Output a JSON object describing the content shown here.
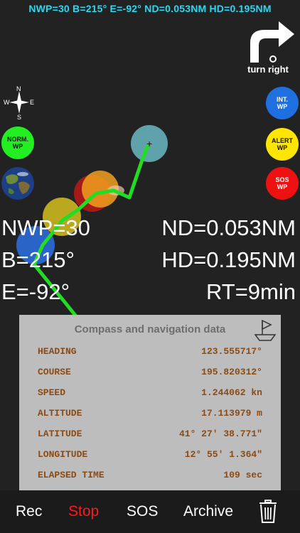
{
  "status_line": "NWP=30 B=215° E=-92° ND=0.053NM HD=0.195NM",
  "turn": {
    "label": "turn right",
    "icon": "turn-right-arrow-icon"
  },
  "compass_rose": {
    "n": "N",
    "s": "S",
    "e": "E",
    "w": "W"
  },
  "waypoint_buttons": {
    "norm": "NORM.\nWP",
    "int": "INT.\nWP",
    "alert": "ALERT\nWP",
    "sos": "SOS\nWP"
  },
  "nav": {
    "nwp": "NWP=30",
    "bearing": "B=215°",
    "error": "E=-92°",
    "nd": "ND=0.053NM",
    "hd": "HD=0.195NM",
    "rt": "RT=9min"
  },
  "panel": {
    "title": "Compass and navigation data",
    "rows": [
      {
        "label": "HEADING",
        "value": "123.555717°"
      },
      {
        "label": "COURSE",
        "value": "195.820312°"
      },
      {
        "label": "SPEED",
        "value": "1.244062 kn"
      },
      {
        "label": "ALTITUDE",
        "value": "17.113979 m"
      },
      {
        "label": "LATITUDE",
        "value": "41° 27' 38.771\""
      },
      {
        "label": "LONGITUDE",
        "value": "12° 55' 1.364\""
      },
      {
        "label": "ELAPSED TIME",
        "value": "109 sec"
      }
    ]
  },
  "tabs": {
    "rec": "Rec",
    "stop": "Stop",
    "sos": "SOS",
    "archive": "Archive"
  },
  "colors": {
    "accent_cyan": "#2fd6ef",
    "stop_red": "#ff1a1a",
    "track_green": "#22dd22",
    "panel_text": "#8b4b14"
  }
}
